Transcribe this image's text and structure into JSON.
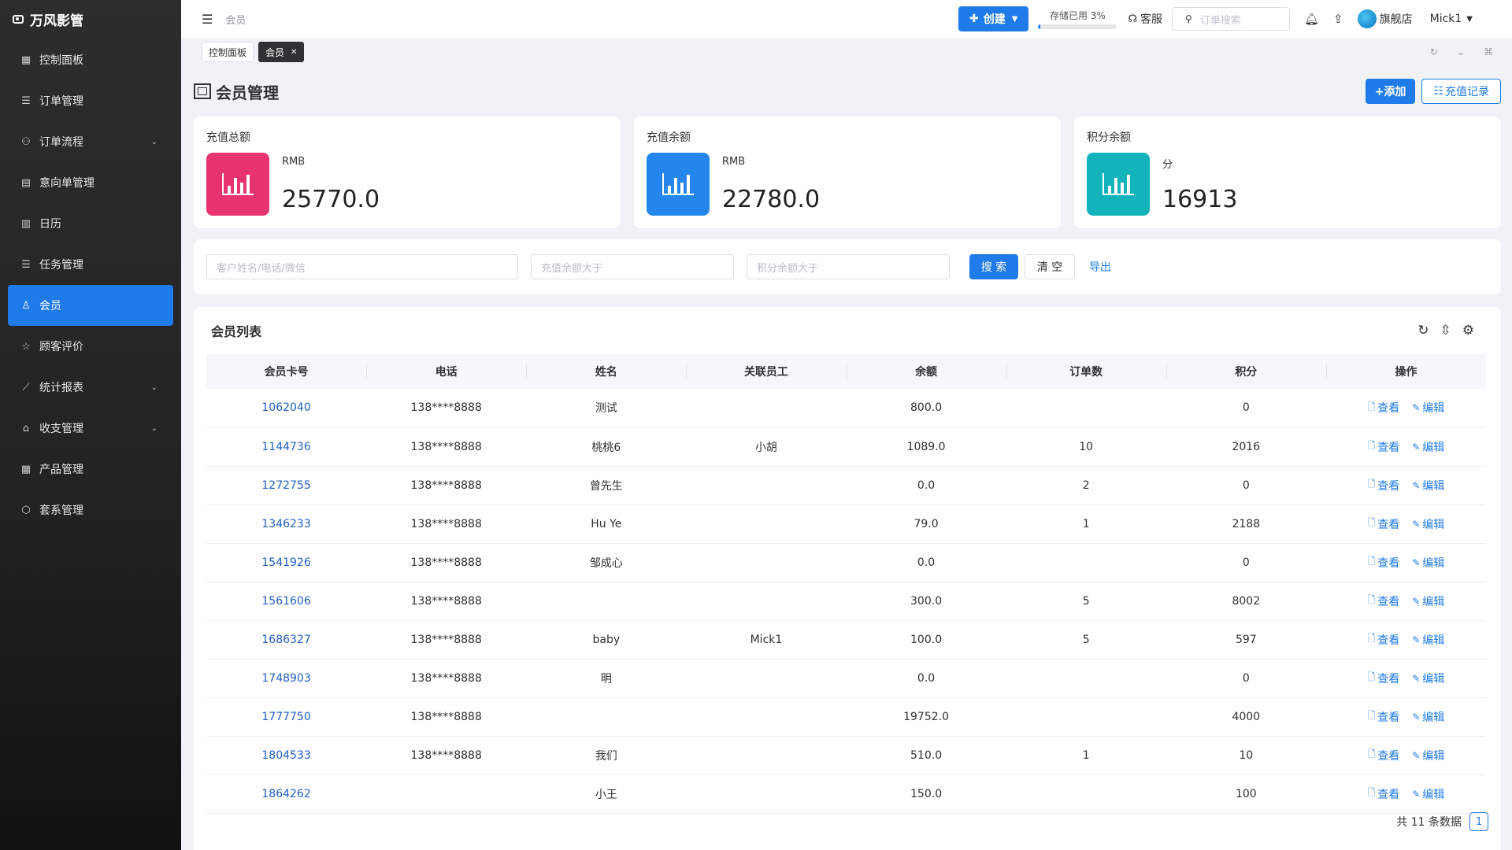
{
  "app": {
    "name": "万风影管"
  },
  "sidebar": {
    "items": [
      {
        "label": "控制面板",
        "icon": "▦",
        "chevron": false,
        "active": false
      },
      {
        "label": "订单管理",
        "icon": "☰",
        "chevron": false,
        "active": false
      },
      {
        "label": "订单流程",
        "icon": "⚇",
        "chevron": true,
        "active": false
      },
      {
        "label": "意向单管理",
        "icon": "▤",
        "chevron": false,
        "active": false
      },
      {
        "label": "日历",
        "icon": "▥",
        "chevron": false,
        "active": false
      },
      {
        "label": "任务管理",
        "icon": "☰",
        "chevron": false,
        "active": false
      },
      {
        "label": "会员",
        "icon": "♙",
        "chevron": false,
        "active": true
      },
      {
        "label": "顾客评价",
        "icon": "☆",
        "chevron": false,
        "active": false
      },
      {
        "label": "统计报表",
        "icon": "⟋",
        "chevron": true,
        "active": false
      },
      {
        "label": "收支管理",
        "icon": "⌂",
        "chevron": true,
        "active": false
      },
      {
        "label": "产品管理",
        "icon": "▦",
        "chevron": false,
        "active": false
      },
      {
        "label": "套系管理",
        "icon": "⬡",
        "chevron": false,
        "active": false
      }
    ]
  },
  "topbar": {
    "breadcrumb": "会员",
    "create_label": "创建",
    "storage_label": "存储已用 3%",
    "storage_percent": 3,
    "service_label": "客服",
    "search_placeholder": "订单搜索",
    "shop_label": "旗舰店",
    "user_name": "Mick1"
  },
  "tabs": [
    {
      "label": "控制面板",
      "active": false
    },
    {
      "label": "会员",
      "active": true,
      "closable": true
    }
  ],
  "page": {
    "title": "会员管理",
    "add_label": "+添加",
    "records_label": "充值记录"
  },
  "stats": [
    {
      "title": "充值总额",
      "unit": "RMB",
      "value": "25770.0",
      "color": "#e7336f"
    },
    {
      "title": "充值余额",
      "unit": "RMB",
      "value": "22780.0",
      "color": "#2486ec"
    },
    {
      "title": "积分余额",
      "unit": "分",
      "value": "16913",
      "color": "#12b3bb"
    }
  ],
  "filter": {
    "name_placeholder": "客户姓名/电话/微信",
    "balance_placeholder": "充值余额大于",
    "points_placeholder": "积分余额大于",
    "search_label": "搜 索",
    "clear_label": "清 空",
    "export_label": "导出"
  },
  "list": {
    "title": "会员列表",
    "columns": [
      "会员卡号",
      "电话",
      "姓名",
      "关联员工",
      "余额",
      "订单数",
      "积分",
      "操作"
    ],
    "view_label": "查看",
    "edit_label": "编辑",
    "rows": [
      {
        "card": "1062040",
        "phone": "138****8888",
        "name": "测试",
        "staff": "",
        "balance": "800.0",
        "orders": "",
        "points": "0"
      },
      {
        "card": "1144736",
        "phone": "138****8888",
        "name": "桃桃6",
        "staff": "小胡",
        "balance": "1089.0",
        "orders": "10",
        "points": "2016"
      },
      {
        "card": "1272755",
        "phone": "138****8888",
        "name": "曾先生",
        "staff": "",
        "balance": "0.0",
        "orders": "2",
        "points": "0"
      },
      {
        "card": "1346233",
        "phone": "138****8888",
        "name": "Hu Ye",
        "staff": "",
        "balance": "79.0",
        "orders": "1",
        "points": "2188"
      },
      {
        "card": "1541926",
        "phone": "138****8888",
        "name": "邹成心",
        "staff": "",
        "balance": "0.0",
        "orders": "",
        "points": "0"
      },
      {
        "card": "1561606",
        "phone": "138****8888",
        "name": "",
        "staff": "",
        "balance": "300.0",
        "orders": "5",
        "points": "8002"
      },
      {
        "card": "1686327",
        "phone": "138****8888",
        "name": "baby",
        "staff": "Mick1",
        "balance": "100.0",
        "orders": "5",
        "points": "597"
      },
      {
        "card": "1748903",
        "phone": "138****8888",
        "name": "明",
        "staff": "",
        "balance": "0.0",
        "orders": "",
        "points": "0"
      },
      {
        "card": "1777750",
        "phone": "138****8888",
        "name": "",
        "staff": "",
        "balance": "19752.0",
        "orders": "",
        "points": "4000"
      },
      {
        "card": "1804533",
        "phone": "138****8888",
        "name": "我们",
        "staff": "",
        "balance": "510.0",
        "orders": "1",
        "points": "10"
      },
      {
        "card": "1864262",
        "phone": "",
        "name": "小王",
        "staff": "",
        "balance": "150.0",
        "orders": "",
        "points": "100"
      }
    ],
    "total_label": "共 11 条数据",
    "current_page": "1"
  }
}
